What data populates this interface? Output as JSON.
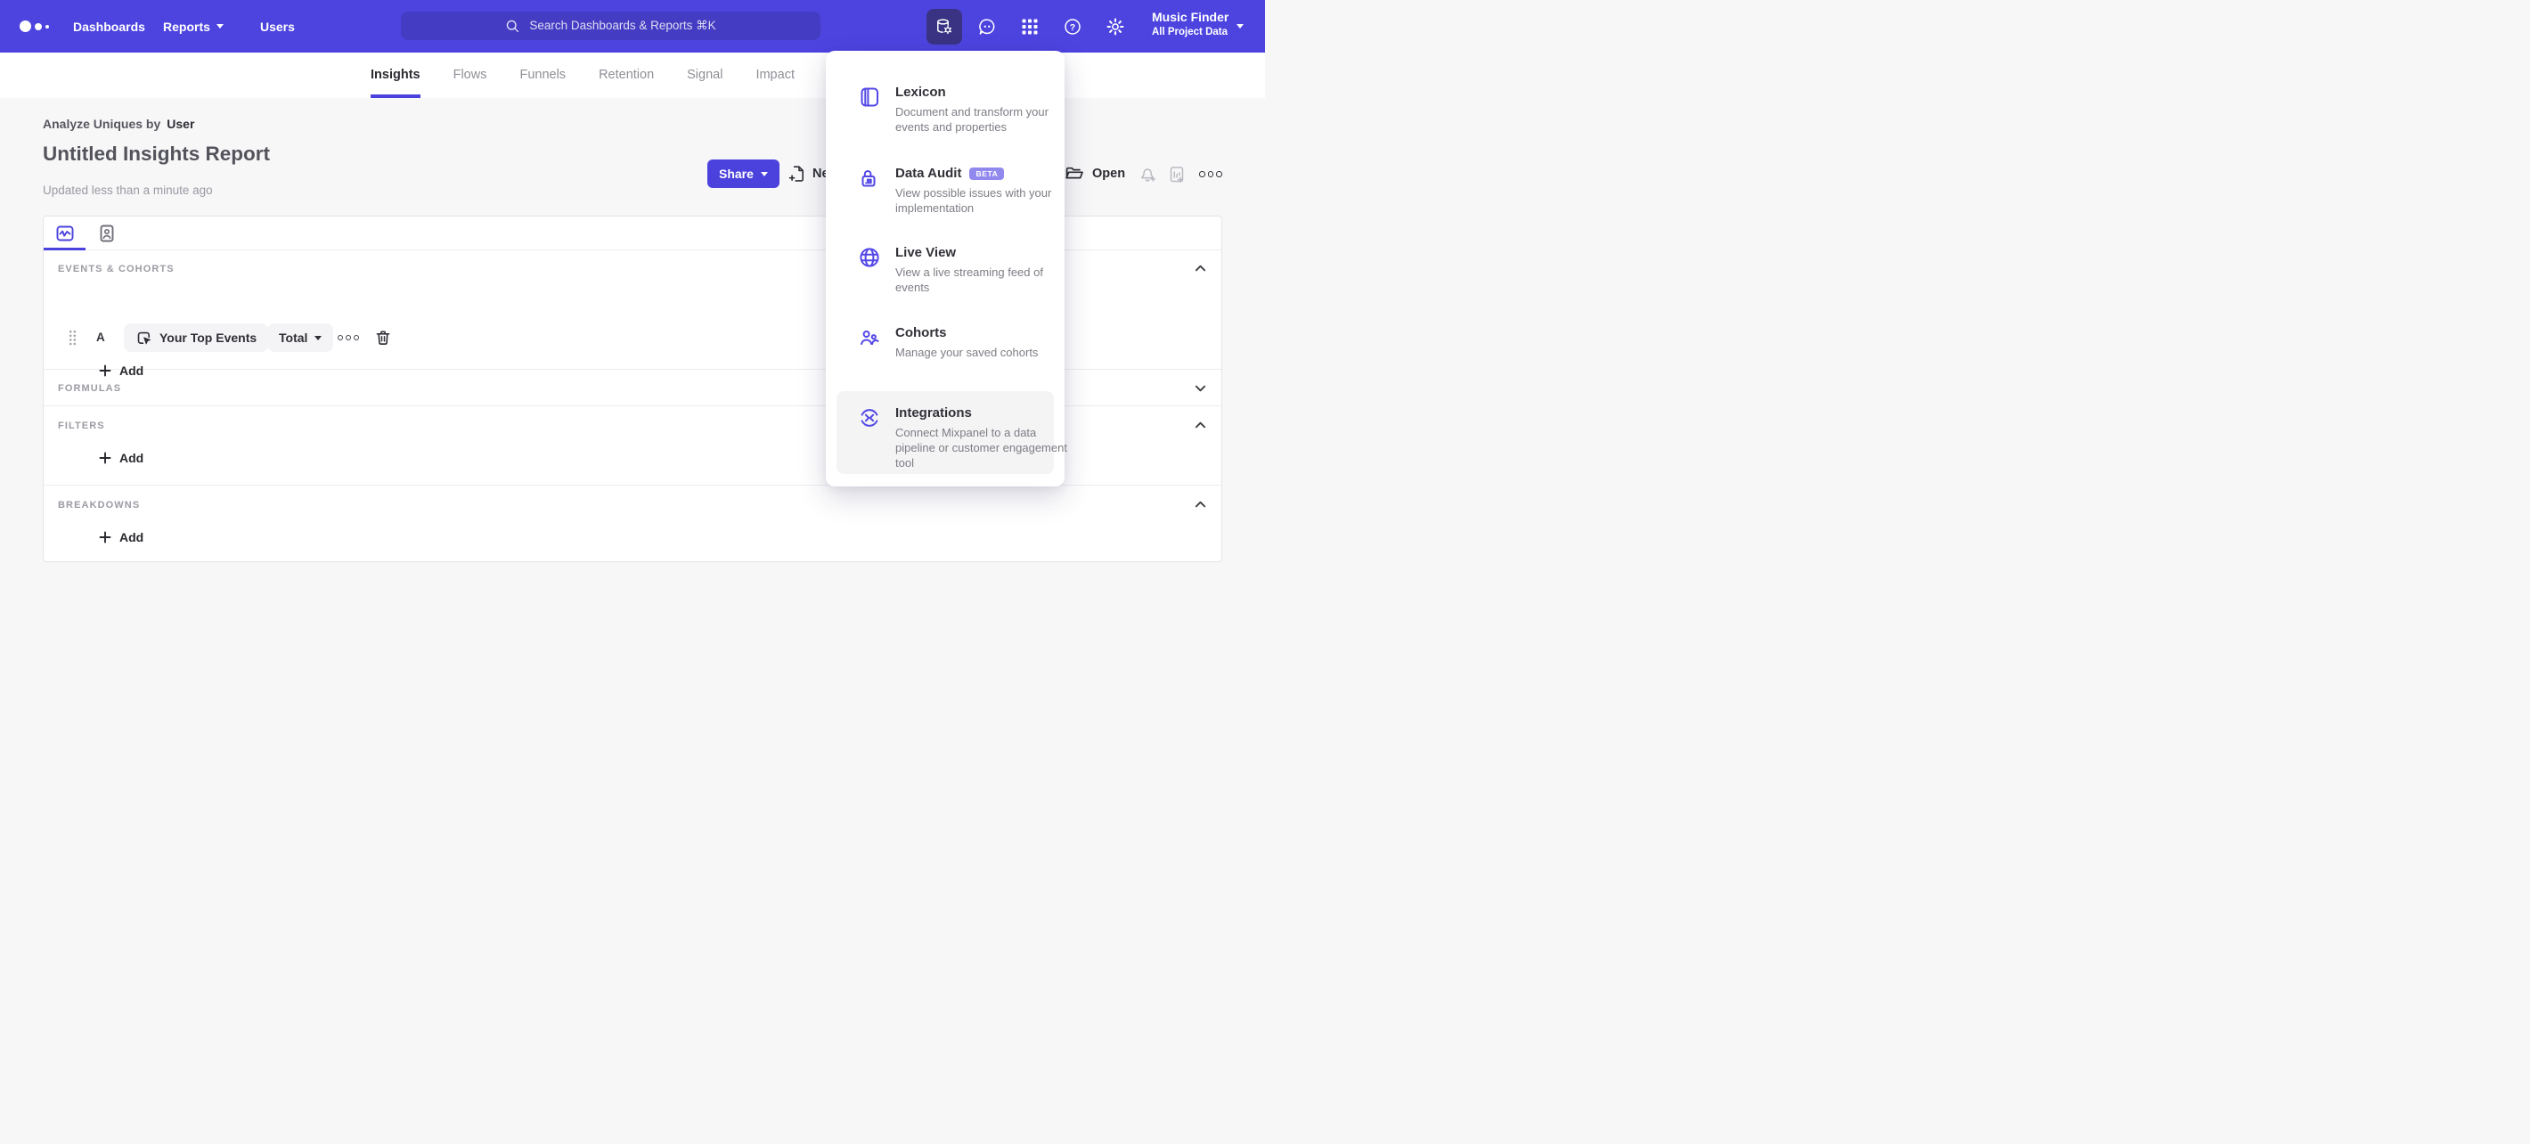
{
  "topbar": {
    "nav": [
      {
        "label": "Dashboards"
      },
      {
        "label": "Reports"
      },
      {
        "label": "Users"
      }
    ],
    "search_placeholder": "Search Dashboards & Reports ⌘K",
    "icon_buttons": [
      "data-management-icon",
      "feedback-icon",
      "apps-grid-icon",
      "help-icon",
      "settings-icon"
    ],
    "project": {
      "name": "Music Finder",
      "scope": "All Project Data"
    }
  },
  "tabs": {
    "items": [
      {
        "label": "Insights"
      },
      {
        "label": "Flows"
      },
      {
        "label": "Funnels"
      },
      {
        "label": "Retention"
      },
      {
        "label": "Signal"
      },
      {
        "label": "Impact"
      }
    ],
    "active": "Insights"
  },
  "header": {
    "analyze_prefix": "Analyze Uniques by",
    "analyze_entity": "User",
    "title": "Untitled Insights Report",
    "updated": "Updated less than a minute ago",
    "share_label": "Share",
    "new_label": "New",
    "open_label": "Open"
  },
  "card": {
    "sections": {
      "events": {
        "label": "EVENTS & COHORTS",
        "row": {
          "letter": "A",
          "event": "Your Top Events",
          "metric": "Total"
        },
        "add_label": "Add"
      },
      "formulas": {
        "label": "FORMULAS"
      },
      "filters": {
        "label": "FILTERS",
        "add_label": "Add"
      },
      "breakdowns": {
        "label": "BREAKDOWNS",
        "add_label": "Add"
      }
    }
  },
  "dropdown": {
    "items": [
      {
        "title": "Lexicon",
        "desc": "Document and transform your events and properties"
      },
      {
        "title": "Data Audit",
        "badge": "BETA",
        "desc": "View possible issues with your implementation"
      },
      {
        "title": "Live View",
        "desc": "View a live streaming feed of events"
      },
      {
        "title": "Cohorts",
        "desc": "Manage your saved cohorts"
      },
      {
        "title": "Integrations",
        "desc": "Connect Mixpanel to a data pipeline or customer engagement tool",
        "highlighted": true
      }
    ]
  },
  "colors": {
    "accent": "#4b42dd",
    "topbar_bg": "#4d44e0",
    "search_bg": "#443cc2",
    "active_icon_bg": "#3a3384",
    "beta_badge_bg": "#9289ee",
    "hover_item_bg": "#f4f4f5"
  }
}
